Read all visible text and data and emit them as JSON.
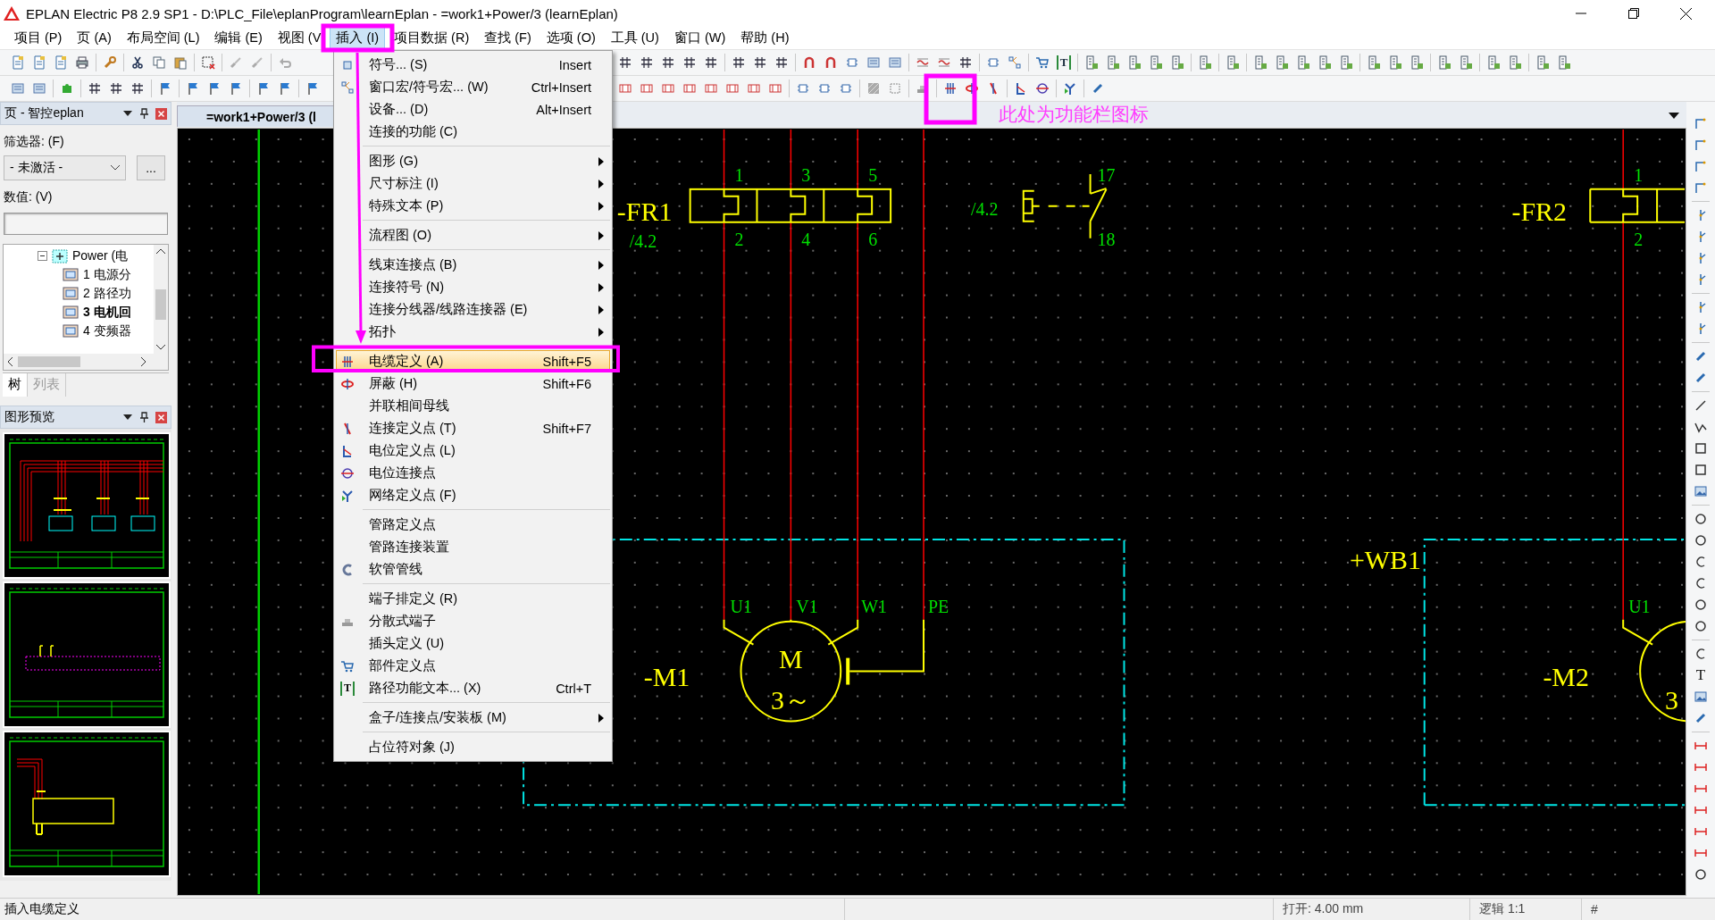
{
  "window": {
    "title": "EPLAN Electric P8 2.9 SP1 - D:\\PLC_File\\eplanProgram\\learnEplan - =work1+Power/3 (learnEplan)"
  },
  "menubar": [
    {
      "label": "项目 (P)",
      "selected": false
    },
    {
      "label": "页 (A)",
      "selected": false
    },
    {
      "label": "布局空间 (L)",
      "selected": false
    },
    {
      "label": "编辑 (E)",
      "selected": false
    },
    {
      "label": "视图 (V",
      "selected": false
    },
    {
      "label": "插入 (I)",
      "selected": true
    },
    {
      "label": "项目数据 (R)",
      "selected": false
    },
    {
      "label": "查找 (F)",
      "selected": false
    },
    {
      "label": "选项 (O)",
      "selected": false
    },
    {
      "label": "工具 (U)",
      "selected": false
    },
    {
      "label": "窗口 (W)",
      "selected": false
    },
    {
      "label": "帮助 (H)",
      "selected": false
    }
  ],
  "toolbar": {
    "text_glyph": "T"
  },
  "page_panel": {
    "title": "页 - 智控eplan",
    "filter_label": "筛选器: (F)",
    "filter_value": "- 未激活 -",
    "filter_button": "...",
    "value_label": "数值: (V)",
    "tree": [
      {
        "label": "Power (电",
        "expanded": true,
        "children": [
          {
            "label": "1 电源分",
            "selected": false
          },
          {
            "label": "2 路径功",
            "selected": false
          },
          {
            "label": "3 电机回",
            "selected": true
          },
          {
            "label": "4 变频器",
            "selected": false
          }
        ]
      }
    ],
    "tabs": [
      {
        "label": "树",
        "selected": true
      },
      {
        "label": "列表",
        "selected": false
      }
    ]
  },
  "preview_panel": {
    "title": "图形预览"
  },
  "document_tab": {
    "label": "=work1+Power/3 (l"
  },
  "schematic": {
    "fr1": {
      "tag": "-FR1",
      "ref": "/4.2",
      "terminals": [
        "1",
        "3",
        "5",
        "2",
        "4",
        "6"
      ]
    },
    "aux_contact": {
      "ref": "/4.2",
      "terminals": [
        "17",
        "18"
      ]
    },
    "fr2": {
      "tag": "-FR2",
      "terminals": [
        "1",
        "2"
      ]
    },
    "location": {
      "tag": "+WB1"
    },
    "motor1": {
      "tag": "-M1",
      "letter": "M",
      "phase": "3～",
      "terminals": [
        "U1",
        "V1",
        "W1",
        "PE"
      ]
    },
    "motor2": {
      "tag": "-M2",
      "phase": "3",
      "terminals": [
        "U1"
      ]
    }
  },
  "menu": {
    "items": [
      {
        "kind": "item",
        "label": "符号... (S)",
        "shortcut": "Insert",
        "submenu": false,
        "selected": false
      },
      {
        "kind": "item",
        "label": "窗口宏/符号宏... (W)",
        "shortcut": "Ctrl+Insert",
        "submenu": false,
        "selected": false
      },
      {
        "kind": "item",
        "label": "设备... (D)",
        "shortcut": "Alt+Insert",
        "submenu": false,
        "selected": false
      },
      {
        "kind": "item",
        "label": "连接的功能 (C)",
        "submenu": false,
        "selected": false
      },
      {
        "kind": "separator"
      },
      {
        "kind": "item",
        "label": "图形 (G)",
        "submenu": true,
        "selected": false
      },
      {
        "kind": "item",
        "label": "尺寸标注 (I)",
        "submenu": true,
        "selected": false
      },
      {
        "kind": "item",
        "label": "特殊文本 (P)",
        "submenu": true,
        "selected": false
      },
      {
        "kind": "separator"
      },
      {
        "kind": "item",
        "label": "流程图 (O)",
        "submenu": true,
        "selected": false
      },
      {
        "kind": "separator"
      },
      {
        "kind": "item",
        "label": "线束连接点 (B)",
        "submenu": true,
        "selected": false
      },
      {
        "kind": "item",
        "label": "连接符号 (N)",
        "submenu": true,
        "selected": false
      },
      {
        "kind": "item",
        "label": "连接分线器/线路连接器 (E)",
        "submenu": true,
        "selected": false
      },
      {
        "kind": "item",
        "label": "拓扑",
        "submenu": true,
        "selected": false
      },
      {
        "kind": "separator"
      },
      {
        "kind": "item",
        "label": "电缆定义 (A)",
        "shortcut": "Shift+F5",
        "submenu": false,
        "selected": true
      },
      {
        "kind": "item",
        "label": "屏蔽 (H)",
        "shortcut": "Shift+F6",
        "submenu": false,
        "selected": false
      },
      {
        "kind": "item",
        "label": "并联相间母线",
        "submenu": false,
        "selected": false
      },
      {
        "kind": "item",
        "label": "连接定义点 (T)",
        "shortcut": "Shift+F7",
        "submenu": false,
        "selected": false
      },
      {
        "kind": "item",
        "label": "电位定义点 (L)",
        "submenu": false,
        "selected": false
      },
      {
        "kind": "item",
        "label": "电位连接点",
        "submenu": false,
        "selected": false
      },
      {
        "kind": "item",
        "label": "网络定义点 (F)",
        "submenu": false,
        "selected": false
      },
      {
        "kind": "separator"
      },
      {
        "kind": "item",
        "label": "管路定义点",
        "submenu": false,
        "selected": false
      },
      {
        "kind": "item",
        "label": "管路连接装置",
        "submenu": false,
        "selected": false
      },
      {
        "kind": "item",
        "label": "软管管线",
        "submenu": false,
        "selected": false
      },
      {
        "kind": "separator"
      },
      {
        "kind": "item",
        "label": "端子排定义 (R)",
        "submenu": false,
        "selected": false
      },
      {
        "kind": "item",
        "label": "分散式端子",
        "submenu": false,
        "selected": false
      },
      {
        "kind": "item",
        "label": "插头定义 (U)",
        "submenu": false,
        "selected": false
      },
      {
        "kind": "item",
        "label": "部件定义点",
        "submenu": false,
        "selected": false
      },
      {
        "kind": "item",
        "label": "路径功能文本... (X)",
        "shortcut": "Ctrl+T",
        "glyph": "T",
        "submenu": false,
        "selected": false
      },
      {
        "kind": "separator"
      },
      {
        "kind": "item",
        "label": "盒子/连接点/安装板 (M)",
        "submenu": true,
        "selected": false
      },
      {
        "kind": "separator"
      },
      {
        "kind": "item",
        "label": "占位符对象 (J)",
        "submenu": false,
        "selected": false
      }
    ]
  },
  "right_toolbar": {
    "text_glyph": "T"
  },
  "annotation": {
    "note": "此处为功能栏图标"
  },
  "status_bar": {
    "message": "插入电缆定义",
    "grid": "打开: 4.00 mm",
    "logic": "逻辑 1:1",
    "hash": "#"
  }
}
